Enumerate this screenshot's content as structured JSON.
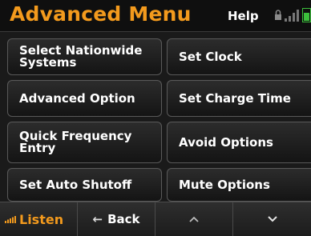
{
  "header": {
    "title": "Advanced Menu",
    "help_label": "Help"
  },
  "menu": {
    "items": [
      {
        "line1": "Select Nationwide",
        "line2": "Systems"
      },
      {
        "line1": "Set Clock"
      },
      {
        "line1": "Advanced Option"
      },
      {
        "line1": "Set Charge Time"
      },
      {
        "line1": "Quick Frequency",
        "line2": "Entry"
      },
      {
        "line1": "Avoid Options"
      },
      {
        "line1": "Set Auto Shutoff"
      },
      {
        "line1": "Mute Options"
      }
    ]
  },
  "bottombar": {
    "listen_label": "Listen",
    "back_label": "Back",
    "back_icon": "←",
    "up_icon": "^",
    "down_icon": "⌄"
  },
  "colors": {
    "accent": "#f39a1d",
    "background": "#1a1a1a",
    "button_border": "#595959",
    "text": "#ffffff"
  }
}
